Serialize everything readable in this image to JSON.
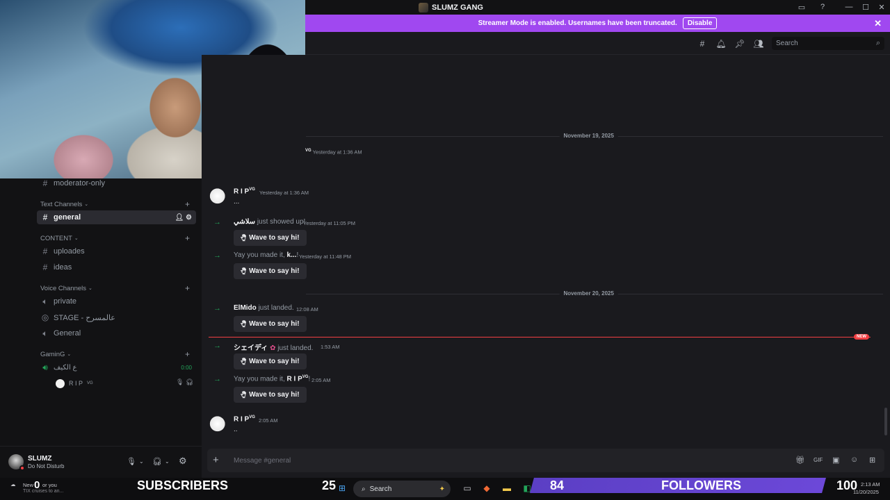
{
  "titlebar": {
    "server_name": "SLUMZ GANG"
  },
  "banner": {
    "text": "Streamer Mode is enabled. Usernames have been truncated.",
    "button": "Disable"
  },
  "header": {
    "search_placeholder": "Search"
  },
  "sidebar": {
    "moderator": "moderator-only",
    "cat_text": "Text Channels",
    "general": "general",
    "cat_content": "CONTENT",
    "uploades": "uploades",
    "ideas": "ideas",
    "cat_voice": "Voice Channels",
    "private": "private",
    "stage": "STAGE - عالمسرح",
    "general_voice": "General",
    "cat_gaming": "GaminG",
    "gaming_channel": "ع الكيف",
    "gaming_timer": "0:00",
    "voice_user": "R I P",
    "voice_user_tag": "VG"
  },
  "user": {
    "name": "SLUMZ",
    "status": "Do Not Disturb"
  },
  "messages": {
    "date1": "November 19, 2025",
    "date2": "November 20, 2025",
    "cut_tag": "VG",
    "cut_time": "Yesterday at 1:36 AM",
    "m1_author": "R I P",
    "m1_tag": "VG",
    "m1_time": "Yesterday at 1:36 AM",
    "m1_text": "...",
    "j1_name": "سلاشي",
    "j1_text": "just showed up!",
    "j1_time": "Yesterday at 11:05 PM",
    "wave": "Wave to say hi!",
    "j2_pre": "Yay you made it,",
    "j2_name": "k...",
    "j2_post": "!",
    "j2_time": "Yesterday at 11:48 PM",
    "j3_name": "ElMido",
    "j3_text": "just landed.",
    "j3_time": "12:08 AM",
    "new_badge": "NEW",
    "j4_name": "シェイディ",
    "j4_text": "just landed.",
    "j4_time": "1:53 AM",
    "j5_pre": "Yay you made it,",
    "j5_name": "R I P",
    "j5_tag": "VG",
    "j5_post": "!",
    "j5_time": "2:05 AM",
    "m2_author": "R I P",
    "m2_tag": "VG",
    "m2_time": "2:05 AM",
    "m2_text": ".."
  },
  "composer": {
    "placeholder": "Message #general"
  },
  "overlay": {
    "news_line1": "New",
    "news_line2": "TIX cruises to an...",
    "news_count": "0",
    "news_after": "or you",
    "subscribers_label": "SUBSCRIBERS",
    "subscribers_count": "25",
    "search": "Search",
    "followers_current": "84",
    "followers_label": "FOLLOWERS",
    "followers_goal": "100",
    "time": "2:13 AM",
    "date": "11/20/2025"
  },
  "colors": {
    "banner": "#a048f0",
    "accent_green": "#23a55a",
    "new_line": "#f23f43",
    "followers_bar": "#6c48d8"
  }
}
